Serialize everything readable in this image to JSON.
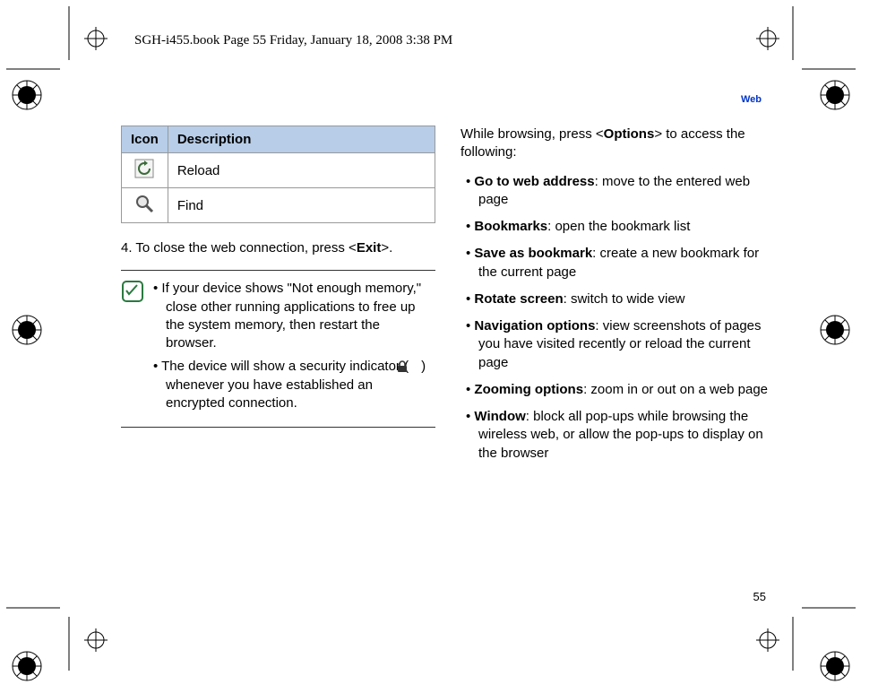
{
  "headerLine": "SGH-i455.book  Page 55  Friday, January 18, 2008  3:38 PM",
  "sectionLabel": "Web",
  "table": {
    "headers": {
      "icon": "Icon",
      "desc": "Description"
    },
    "rows": [
      {
        "label": "Reload"
      },
      {
        "label": "Find"
      }
    ]
  },
  "step4_a": "4. To close the web connection, press <",
  "step4_bold": "Exit",
  "step4_b": ">.",
  "note": {
    "item1": "• If your device shows \"Not enough memory,\" close other running applications to free up the system memory, then restart the browser.",
    "item2_a": "• The device will show a security indicator (",
    "item2_b": ") whenever you have established an encrypted connection."
  },
  "intro_a": "While browsing, press <",
  "intro_bold": "Options",
  "intro_b": "> to access the following:",
  "options": [
    {
      "name": "Go to web address",
      "desc": ": move to the entered web page"
    },
    {
      "name": "Bookmarks",
      "desc": ": open the bookmark list"
    },
    {
      "name": "Save as bookmark",
      "desc": ": create a new bookmark for the current page"
    },
    {
      "name": "Rotate screen",
      "desc": ": switch to wide view"
    },
    {
      "name": "Navigation options",
      "desc": ": view screenshots of pages you have visited recently or reload the current page"
    },
    {
      "name": "Zooming options",
      "desc": ": zoom in or out on a web page"
    },
    {
      "name": "Window",
      "desc": ": block all pop-ups while browsing the wireless web, or allow the pop-ups to display on the browser"
    }
  ],
  "pageNumber": "55"
}
